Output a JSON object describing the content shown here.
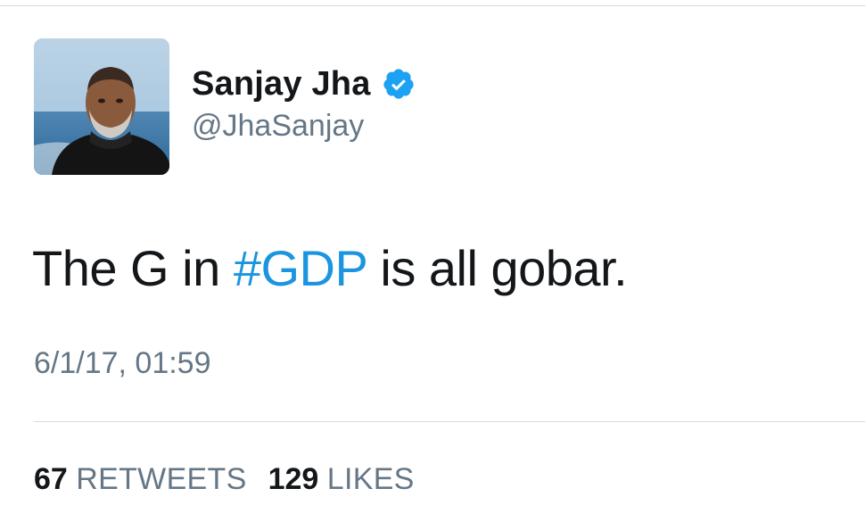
{
  "tweet": {
    "author": {
      "display_name": "Sanjay Jha",
      "handle": "@JhaSanjay",
      "verified": true,
      "avatar_icon": "profile-photo"
    },
    "text_before": "The G in ",
    "hashtag": "#GDP",
    "text_after": " is all gobar.",
    "timestamp": "6/1/17, 01:59",
    "stats": {
      "retweets_count": "67",
      "retweets_label": "RETWEETS",
      "likes_count": "129",
      "likes_label": "LIKES"
    }
  },
  "colors": {
    "hashtag": "#1b95e0",
    "verified_badge": "#1da1f2",
    "secondary_text": "#657786",
    "primary_text": "#14171a",
    "divider": "#d8dcdf"
  }
}
